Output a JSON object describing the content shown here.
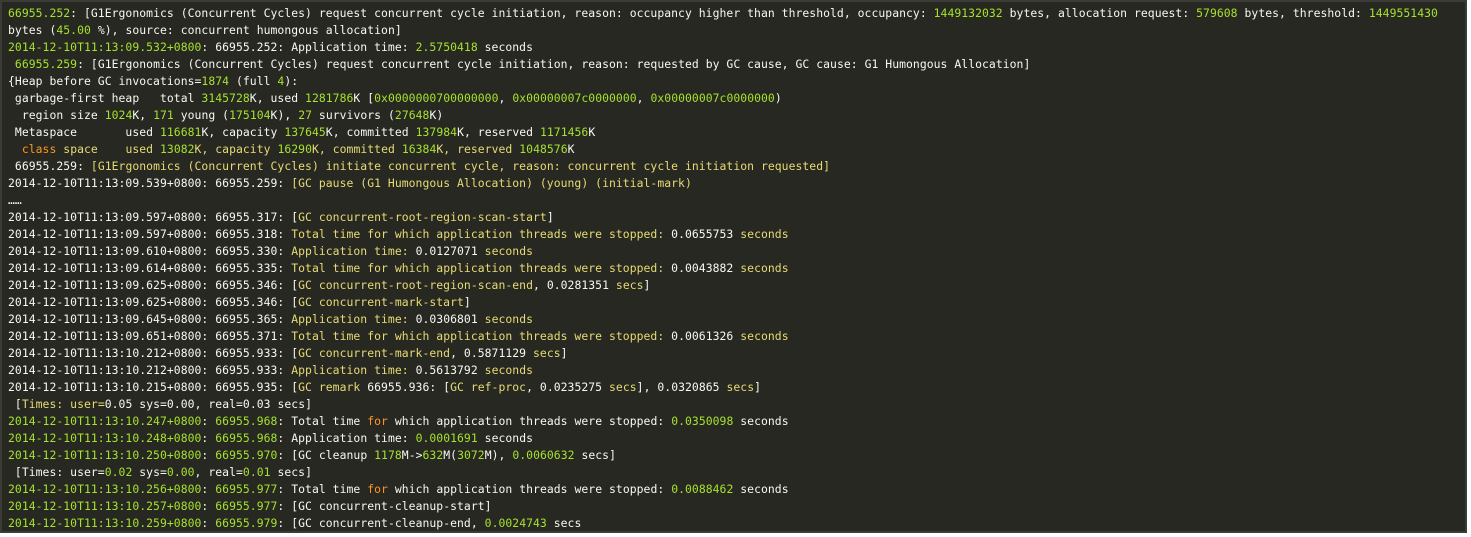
{
  "colors": {
    "background": "#272822",
    "text": "#f8f8f2",
    "numeric": "#a6e22e",
    "yellow": "#e6db74",
    "keyword": "#fd971f"
  },
  "log_lines": [
    [
      [
        "66955.252",
        "t-green"
      ],
      [
        ": [G1Ergonomics (Concurrent Cycles) request concurrent cycle initiation, reason: occupancy higher than threshold, occupancy: ",
        ""
      ],
      [
        "1449132032",
        "t-green"
      ],
      [
        " bytes, allocation request: ",
        ""
      ],
      [
        "579608",
        "t-green"
      ],
      [
        " bytes, threshold: ",
        ""
      ],
      [
        "1449551430",
        "t-green"
      ],
      [
        " bytes (",
        ""
      ],
      [
        "45.00",
        "t-green"
      ],
      [
        " %), source: concurrent humongous allocation]",
        ""
      ]
    ],
    [
      [
        "2014-12-10T11:13:09.532+0800",
        "t-green"
      ],
      [
        ": 66955.252: Application time: ",
        ""
      ],
      [
        "2.5750418",
        "t-green"
      ],
      [
        " seconds",
        ""
      ]
    ],
    [
      [
        " ",
        ""
      ],
      [
        "66955.259",
        "t-green"
      ],
      [
        ": [G1Ergonomics (Concurrent Cycles) request concurrent cycle initiation, reason: requested by GC cause, GC cause: G1 Humongous Allocation]",
        ""
      ]
    ],
    [
      [
        "{Heap before GC invocations=",
        ""
      ],
      [
        "1874",
        "t-green"
      ],
      [
        " (full ",
        ""
      ],
      [
        "4",
        "t-green"
      ],
      [
        "):",
        ""
      ]
    ],
    [
      [
        " garbage-first heap   total ",
        ""
      ],
      [
        "3145728",
        "t-green"
      ],
      [
        "K, used ",
        ""
      ],
      [
        "1281786",
        "t-green"
      ],
      [
        "K [",
        ""
      ],
      [
        "0x0000000700000000",
        "t-green"
      ],
      [
        ", ",
        ""
      ],
      [
        "0x00000007c0000000",
        "t-green"
      ],
      [
        ", ",
        ""
      ],
      [
        "0x00000007c0000000",
        "t-green"
      ],
      [
        ")",
        ""
      ]
    ],
    [
      [
        "  region size ",
        ""
      ],
      [
        "1024",
        "t-green"
      ],
      [
        "K, ",
        ""
      ],
      [
        "171",
        "t-green"
      ],
      [
        " young (",
        ""
      ],
      [
        "175104",
        "t-green"
      ],
      [
        "K), ",
        ""
      ],
      [
        "27",
        "t-green"
      ],
      [
        " survivors (",
        ""
      ],
      [
        "27648",
        "t-green"
      ],
      [
        "K)",
        ""
      ]
    ],
    [
      [
        " Metaspace       used ",
        ""
      ],
      [
        "116681",
        "t-green"
      ],
      [
        "K, capacity ",
        ""
      ],
      [
        "137645",
        "t-green"
      ],
      [
        "K, committed ",
        ""
      ],
      [
        "137984",
        "t-green"
      ],
      [
        "K, reserved ",
        ""
      ],
      [
        "1171456",
        "t-green"
      ],
      [
        "K",
        ""
      ]
    ],
    [
      [
        "  ",
        ""
      ],
      [
        "class",
        "t-kw"
      ],
      [
        " space    used ",
        "t-warn"
      ],
      [
        "13082",
        "t-green"
      ],
      [
        "K, capacity ",
        "t-warn"
      ],
      [
        "16290",
        "t-green"
      ],
      [
        "K, committed ",
        "t-warn"
      ],
      [
        "16384",
        "t-green"
      ],
      [
        "K, reserved ",
        "t-warn"
      ],
      [
        "1048576",
        "t-green"
      ],
      [
        "K",
        ""
      ]
    ],
    [
      [
        " 66955.259: ",
        ""
      ],
      [
        "[G1Ergonomics (Concurrent Cycles) initiate concurrent cycle, reason: concurrent cycle initiation requested]",
        "t-warn"
      ]
    ],
    [
      [
        "2014-12-10T11:13:09.539+0800: 66955.259: ",
        ""
      ],
      [
        "[GC pause (G1 Humongous Allocation) (young) (initial-mark)",
        "t-warn"
      ]
    ],
    [
      [
        "……",
        ""
      ]
    ],
    [
      [
        "2014-12-10T11:13:09.597+0800: 66955.317: [",
        ""
      ],
      [
        "GC concurrent-root-region-scan-start",
        "t-warn"
      ],
      [
        "]",
        ""
      ]
    ],
    [
      [
        "2014-12-10T11:13:09.597+0800: 66955.318: ",
        ""
      ],
      [
        "Total time for which application threads were stopped:",
        "t-warn"
      ],
      [
        " 0.0655753 ",
        ""
      ],
      [
        "seconds",
        "t-warn"
      ]
    ],
    [
      [
        "2014-12-10T11:13:09.610+0800: 66955.330: ",
        ""
      ],
      [
        "Application time:",
        "t-warn"
      ],
      [
        " 0.0127071 ",
        ""
      ],
      [
        "seconds",
        "t-warn"
      ]
    ],
    [
      [
        "2014-12-10T11:13:09.614+0800: 66955.335: ",
        ""
      ],
      [
        "Total time for which application threads were stopped:",
        "t-warn"
      ],
      [
        " 0.0043882 ",
        ""
      ],
      [
        "seconds",
        "t-warn"
      ]
    ],
    [
      [
        "2014-12-10T11:13:09.625+0800: 66955.346: [",
        ""
      ],
      [
        "GC concurrent-root-region-scan-end",
        "t-warn"
      ],
      [
        ", 0.0281351 ",
        ""
      ],
      [
        "secs",
        "t-warn"
      ],
      [
        "]",
        ""
      ]
    ],
    [
      [
        "2014-12-10T11:13:09.625+0800: 66955.346: [",
        ""
      ],
      [
        "GC concurrent-mark-start",
        "t-warn"
      ],
      [
        "]",
        ""
      ]
    ],
    [
      [
        "2014-12-10T11:13:09.645+0800: 66955.365: ",
        ""
      ],
      [
        "Application time:",
        "t-warn"
      ],
      [
        " 0.0306801 ",
        ""
      ],
      [
        "seconds",
        "t-warn"
      ]
    ],
    [
      [
        "2014-12-10T11:13:09.651+0800: 66955.371: ",
        ""
      ],
      [
        "Total time for which application threads were stopped:",
        "t-warn"
      ],
      [
        " 0.0061326 ",
        ""
      ],
      [
        "seconds",
        "t-warn"
      ]
    ],
    [
      [
        "2014-12-10T11:13:10.212+0800: 66955.933: [",
        ""
      ],
      [
        "GC concurrent-mark-end",
        "t-warn"
      ],
      [
        ", 0.5871129 ",
        ""
      ],
      [
        "secs",
        "t-warn"
      ],
      [
        "]",
        ""
      ]
    ],
    [
      [
        "2014-12-10T11:13:10.212+0800: 66955.933: ",
        ""
      ],
      [
        "Application time:",
        "t-warn"
      ],
      [
        " 0.5613792 ",
        ""
      ],
      [
        "seconds",
        "t-warn"
      ]
    ],
    [
      [
        "2014-12-10T11:13:10.215+0800: 66955.935: [",
        ""
      ],
      [
        "GC remark",
        "t-warn"
      ],
      [
        " 66955.936: [",
        ""
      ],
      [
        "GC ref-proc",
        "t-warn"
      ],
      [
        ", 0.0235275 ",
        ""
      ],
      [
        "secs",
        "t-warn"
      ],
      [
        "], 0.0320865 ",
        ""
      ],
      [
        "secs",
        "t-warn"
      ],
      [
        "]",
        ""
      ]
    ],
    [
      [
        " [",
        ""
      ],
      [
        "Times: user=",
        "t-warn"
      ],
      [
        "0.05",
        ""
      ],
      [
        " sys=",
        ""
      ],
      [
        "0.00",
        ""
      ],
      [
        ", real=",
        ""
      ],
      [
        "0.03",
        ""
      ],
      [
        " secs]",
        ""
      ]
    ],
    [
      [
        "2014-12-10T11:13:10.247+0800",
        "t-green"
      ],
      [
        ": ",
        ""
      ],
      [
        "66955.968",
        "t-green"
      ],
      [
        ": Total time ",
        ""
      ],
      [
        "for",
        "t-kw"
      ],
      [
        " which application threads were stopped: ",
        ""
      ],
      [
        "0.0350098",
        "t-green"
      ],
      [
        " seconds",
        ""
      ]
    ],
    [
      [
        "2014-12-10T11:13:10.248+0800",
        "t-green"
      ],
      [
        ": ",
        ""
      ],
      [
        "66955.968",
        "t-green"
      ],
      [
        ": Application time: ",
        ""
      ],
      [
        "0.0001691",
        "t-green"
      ],
      [
        " seconds",
        ""
      ]
    ],
    [
      [
        "2014-12-10T11:13:10.250+0800",
        "t-green"
      ],
      [
        ": ",
        ""
      ],
      [
        "66955.970",
        "t-green"
      ],
      [
        ": [GC cleanup ",
        ""
      ],
      [
        "1178",
        "t-green"
      ],
      [
        "M->",
        ""
      ],
      [
        "632",
        "t-green"
      ],
      [
        "M(",
        ""
      ],
      [
        "3072",
        "t-green"
      ],
      [
        "M), ",
        ""
      ],
      [
        "0.0060632",
        "t-green"
      ],
      [
        " secs]",
        ""
      ]
    ],
    [
      [
        " [Times: user=",
        ""
      ],
      [
        "0.02",
        "t-green"
      ],
      [
        " sys=",
        ""
      ],
      [
        "0.00",
        "t-green"
      ],
      [
        ", real=",
        ""
      ],
      [
        "0.01",
        "t-green"
      ],
      [
        " secs]",
        ""
      ]
    ],
    [
      [
        "2014-12-10T11:13:10.256+0800",
        "t-green"
      ],
      [
        ": ",
        ""
      ],
      [
        "66955.977",
        "t-green"
      ],
      [
        ": Total time ",
        ""
      ],
      [
        "for",
        "t-kw"
      ],
      [
        " which application threads were stopped: ",
        ""
      ],
      [
        "0.0088462",
        "t-green"
      ],
      [
        " seconds",
        ""
      ]
    ],
    [
      [
        "2014-12-10T11:13:10.257+0800",
        "t-green"
      ],
      [
        ": ",
        ""
      ],
      [
        "66955.977",
        "t-green"
      ],
      [
        ": [GC concurrent-cleanup-start]",
        ""
      ]
    ],
    [
      [
        "2014-12-10T11:13:10.259+0800",
        "t-green"
      ],
      [
        ": ",
        ""
      ],
      [
        "66955.979",
        "t-green"
      ],
      [
        ": [GC concurrent-cleanup-end, ",
        ""
      ],
      [
        "0.0024743",
        "t-green"
      ],
      [
        " secs",
        ""
      ]
    ]
  ]
}
